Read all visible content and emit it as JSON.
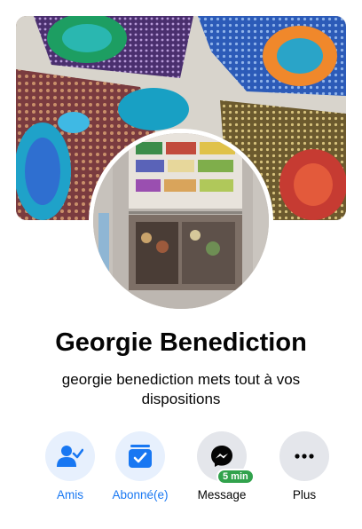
{
  "profile": {
    "name": "Georgie Benediction",
    "bio": "georgie benediction mets tout à vos dispositions"
  },
  "actions": [
    {
      "label": "Amis",
      "icon": "friends-check-icon",
      "style": "blue"
    },
    {
      "label": "Abonné(e)",
      "icon": "subscribed-check-icon",
      "style": "blue"
    },
    {
      "label": "Message",
      "icon": "messenger-icon",
      "style": "gray",
      "badge": "5 min"
    },
    {
      "label": "Plus",
      "icon": "more-dots-icon",
      "style": "gray"
    }
  ],
  "colors": {
    "accent": "#1877f2",
    "accent_bg": "#e7f0fd",
    "neutral_bg": "#e4e6eb",
    "badge": "#31a24c"
  }
}
